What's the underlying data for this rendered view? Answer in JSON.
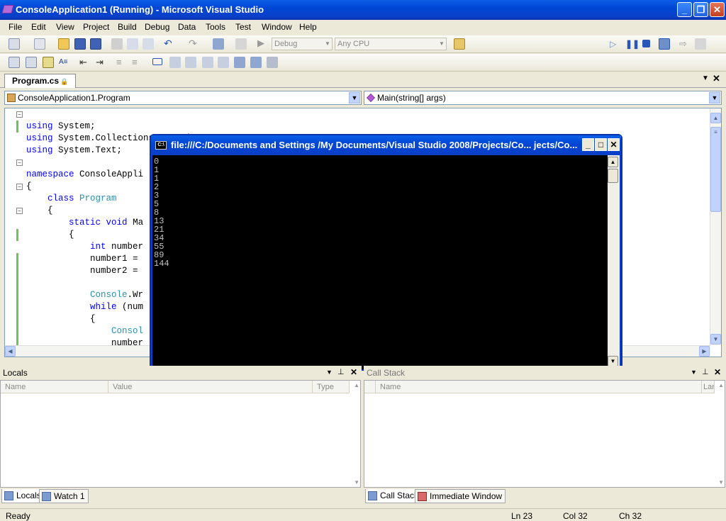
{
  "window": {
    "title": "ConsoleApplication1 (Running) - Microsoft Visual Studio"
  },
  "menu": [
    "File",
    "Edit",
    "View",
    "Project",
    "Build",
    "Debug",
    "Data",
    "Tools",
    "Test",
    "Window",
    "Help"
  ],
  "toolbar": {
    "config": "Debug",
    "platform": "Any CPU"
  },
  "doc_tab": {
    "label": "Program.cs"
  },
  "nav": {
    "class_combo": "ConsoleApplication1.Program",
    "member_combo": "Main(string[] args)"
  },
  "code": {
    "lines": [
      "using System;",
      "using System.Collections.Generic;",
      "using System.Text;",
      "",
      "namespace ConsoleAppli",
      "{",
      "    class Program",
      "    {",
      "        static void Ma",
      "        {",
      "            int number",
      "            number1 = ",
      "            number2 = ",
      "",
      "            Console.Wr",
      "            while (num",
      "            {",
      "                Consol",
      "                number",
      "                number"
    ]
  },
  "console": {
    "title": "file:///C:/Documents and Settings /My Documents/Visual Studio 2008/Projects/Co... jects/Co...",
    "output": [
      "0",
      "1",
      "1",
      "2",
      "3",
      "5",
      "8",
      "13",
      "21",
      "34",
      "55",
      "89",
      "144"
    ]
  },
  "locals": {
    "title": "Locals",
    "columns": [
      "Name",
      "Value",
      "Type"
    ]
  },
  "callstack": {
    "title": "Call Stack",
    "columns": [
      "Name",
      "Lang"
    ]
  },
  "bottom_tabs_left": [
    "Locals",
    "Watch 1"
  ],
  "bottom_tabs_right": [
    "Call Stack",
    "Immediate Window"
  ],
  "status": {
    "ready": "Ready",
    "ln": "Ln 23",
    "col": "Col 32",
    "ch": "Ch 32"
  }
}
